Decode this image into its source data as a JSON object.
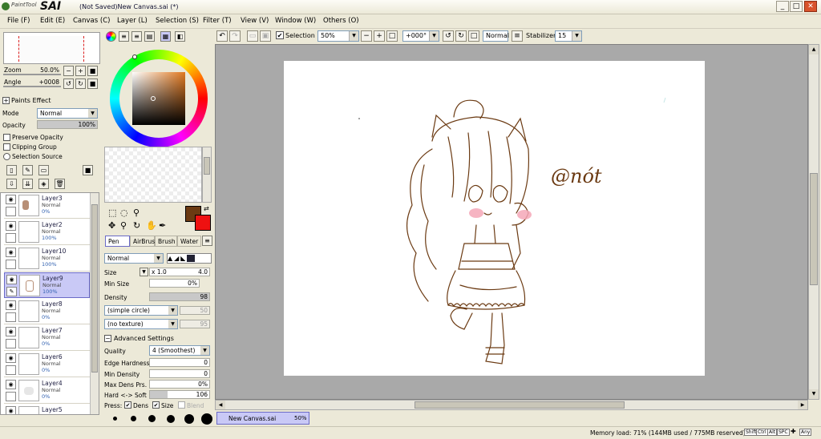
{
  "app": {
    "logo_small": "PaintTool",
    "logo_big": "SAI",
    "window_title": "(Not Saved)New Canvas.sai (*)"
  },
  "window_controls": {
    "minimize": "_",
    "maximize": "□",
    "close": "✕"
  },
  "menu": [
    {
      "label": "File (F)"
    },
    {
      "label": "Edit (E)"
    },
    {
      "label": "Canvas (C)"
    },
    {
      "label": "Layer (L)"
    },
    {
      "label": "Selection (S)"
    },
    {
      "label": "Filter (T)"
    },
    {
      "label": "View (V)"
    },
    {
      "label": "Window (W)"
    },
    {
      "label": "Others (O)"
    }
  ],
  "toolbar": {
    "selection_label": "Selection",
    "selection_checked": true,
    "zoom_value": "50%",
    "rotation_value": "+000°",
    "blend_mode": "Normal",
    "stabilizer_label": "Stabilizer",
    "stabilizer_value": "15"
  },
  "navigator": {
    "zoom_label": "Zoom",
    "zoom_value": "50.0%",
    "angle_label": "Angle",
    "angle_value": "+0008"
  },
  "paints_effect": {
    "title": "Paints Effect",
    "mode_label": "Mode",
    "mode_value": "Normal",
    "opacity_label": "Opacity",
    "opacity_value": "100%",
    "preserve_opacity": "Preserve Opacity",
    "clipping_group": "Clipping Group",
    "selection_source": "Selection Source"
  },
  "layers": [
    {
      "name": "Layer3",
      "mode": "Normal",
      "opacity": "0%",
      "selected": false
    },
    {
      "name": "Layer2",
      "mode": "Normal",
      "opacity": "100%",
      "selected": false
    },
    {
      "name": "Layer10",
      "mode": "Normal",
      "opacity": "100%",
      "selected": false
    },
    {
      "name": "Layer9",
      "mode": "Normal",
      "opacity": "100%",
      "selected": true
    },
    {
      "name": "Layer8",
      "mode": "Normal",
      "opacity": "0%",
      "selected": false
    },
    {
      "name": "Layer7",
      "mode": "Normal",
      "opacity": "0%",
      "selected": false
    },
    {
      "name": "Layer6",
      "mode": "Normal",
      "opacity": "0%",
      "selected": false
    },
    {
      "name": "Layer4",
      "mode": "Normal",
      "opacity": "0%",
      "selected": false
    },
    {
      "name": "Layer5",
      "mode": "",
      "opacity": "",
      "selected": false
    }
  ],
  "colors": {
    "primary": "#6b3a12",
    "secondary": "#ee1111",
    "accent_selection": "#c9c9f6",
    "canvas_bg": "#a9a9a9"
  },
  "tool_tabs": [
    {
      "label": "Pen",
      "active": true
    },
    {
      "label": "AirBrush",
      "active": false
    },
    {
      "label": "Brush",
      "active": false
    },
    {
      "label": "Water",
      "active": false
    }
  ],
  "tool_settings": {
    "blend_mode": "Normal",
    "size_label": "Size",
    "size_multiplier": "x 1.0",
    "size_value": "4.0",
    "min_size_label": "Min Size",
    "min_size_value": "0%",
    "density_label": "Density",
    "density_value": "98",
    "shape_value": "(simple circle)",
    "shape_amount": "50",
    "texture_value": "(no texture)",
    "texture_amount": "95",
    "advanced_settings": "Advanced Settings",
    "quality_label": "Quality",
    "quality_value": "4 (Smoothest)",
    "edge_hardness_label": "Edge Hardness",
    "edge_hardness_value": "0",
    "min_density_label": "Min Density",
    "min_density_value": "0",
    "max_dens_prs_label": "Max Dens Prs.",
    "max_dens_prs_value": "0%",
    "hard_soft_label": "Hard <-> Soft",
    "hard_soft_value": "106",
    "press_label": "Press:",
    "press_dens": "Dens",
    "press_size": "Size",
    "press_blend": "Blend"
  },
  "canvas": {
    "watermark": "@nót"
  },
  "document_tab": {
    "name": "New Canvas.sai",
    "zoom": "50%"
  },
  "status": {
    "memory": "Memory load: 71% (144MB used / 775MB reserved)",
    "keys": [
      "Shift",
      "Ctrl",
      "Alt",
      "SPC",
      "Any"
    ]
  }
}
